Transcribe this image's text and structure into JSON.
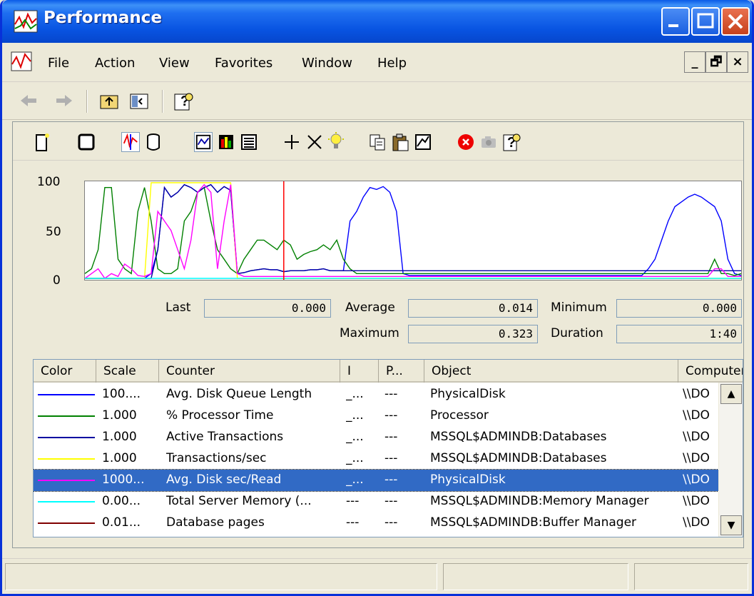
{
  "window": {
    "title": "Performance"
  },
  "menu": {
    "items": [
      {
        "label": "File",
        "mnemonic": "F"
      },
      {
        "label": "Action",
        "mnemonic": "A"
      },
      {
        "label": "View",
        "mnemonic": "V"
      },
      {
        "label": "Favorites",
        "mnemonic": "o"
      },
      {
        "label": "Window",
        "mnemonic": "W"
      },
      {
        "label": "Help",
        "mnemonic": "H"
      }
    ],
    "mdi": {
      "minimize": "_",
      "restore": "🗗",
      "close": "×"
    }
  },
  "stats": {
    "last_label": "Last",
    "last_value": "0.000",
    "average_label": "Average",
    "average_value": "0.014",
    "minimum_label": "Minimum",
    "minimum_value": "0.000",
    "maximum_label": "Maximum",
    "maximum_value": "0.323",
    "duration_label": "Duration",
    "duration_value": "1:40"
  },
  "list": {
    "columns": [
      "Color",
      "Scale",
      "Counter",
      "I",
      "P...",
      "Object",
      "Computer"
    ],
    "rows": [
      {
        "color": "#0000ff",
        "scale": "100....",
        "counter": "Avg. Disk Queue Length",
        "instance": "_...",
        "parent": "---",
        "object": "PhysicalDisk",
        "computer": "\\\\DO"
      },
      {
        "color": "#008000",
        "scale": "1.000",
        "counter": "% Processor Time",
        "instance": "_...",
        "parent": "---",
        "object": "Processor",
        "computer": "\\\\DO"
      },
      {
        "color": "#0000a0",
        "scale": "1.000",
        "counter": "Active Transactions",
        "instance": "_...",
        "parent": "---",
        "object": "MSSQL$ADMINDB:Databases",
        "computer": "\\\\DO"
      },
      {
        "color": "#ffff00",
        "scale": "1.000",
        "counter": "Transactions/sec",
        "instance": "_...",
        "parent": "---",
        "object": "MSSQL$ADMINDB:Databases",
        "computer": "\\\\DO"
      },
      {
        "color": "#ff00ff",
        "scale": "1000...",
        "counter": "Avg. Disk sec/Read",
        "instance": "_...",
        "parent": "---",
        "object": "PhysicalDisk",
        "computer": "\\\\DO",
        "selected": true
      },
      {
        "color": "#00ffff",
        "scale": "0.00...",
        "counter": "Total Server Memory (...",
        "instance": "---",
        "parent": "---",
        "object": "MSSQL$ADMINDB:Memory Manager",
        "computer": "\\\\DO"
      },
      {
        "color": "#800000",
        "scale": "0.01...",
        "counter": "Database pages",
        "instance": "---",
        "parent": "---",
        "object": "MSSQL$ADMINDB:Buffer Manager",
        "computer": "\\\\DO"
      }
    ]
  },
  "chart_data": {
    "type": "line",
    "ylim": [
      0,
      100
    ],
    "yticks": [
      "100",
      "50",
      "0"
    ],
    "x": [
      0,
      1,
      2,
      3,
      4,
      5,
      6,
      7,
      8,
      9,
      10,
      11,
      12,
      13,
      14,
      15,
      16,
      17,
      18,
      19,
      20,
      21,
      22,
      23,
      24,
      25,
      26,
      27,
      28,
      29,
      30,
      31,
      32,
      33,
      34,
      35,
      36,
      37,
      38,
      39,
      40,
      41,
      42,
      43,
      44,
      45,
      46,
      47,
      48,
      49,
      50,
      51,
      52,
      53,
      54,
      55,
      56,
      57,
      58,
      59,
      60,
      61,
      62,
      63,
      64,
      65,
      66,
      67,
      68,
      69,
      70,
      71,
      72,
      73,
      74,
      75,
      76,
      77,
      78,
      79,
      80,
      81,
      82,
      83,
      84,
      85,
      86,
      87,
      88,
      89,
      90,
      91,
      92,
      93,
      94,
      95,
      96,
      97,
      98,
      99
    ],
    "series": [
      {
        "color": "#0000ff",
        "values": [
          0,
          0,
          0,
          0,
          0,
          0,
          0,
          0,
          0,
          0,
          5,
          30,
          95,
          85,
          90,
          98,
          95,
          90,
          95,
          98,
          90,
          96,
          92,
          5,
          6,
          8,
          9,
          10,
          9,
          9,
          7,
          8,
          8,
          8,
          9,
          9,
          10,
          8,
          8,
          8,
          60,
          70,
          85,
          95,
          93,
          96,
          90,
          70,
          5,
          3,
          3,
          3,
          3,
          3,
          3,
          3,
          3,
          3,
          3,
          3,
          3,
          3,
          3,
          3,
          3,
          3,
          3,
          3,
          3,
          3,
          3,
          3,
          3,
          3,
          3,
          3,
          3,
          3,
          3,
          3,
          3,
          3,
          3,
          3,
          3,
          10,
          20,
          40,
          60,
          75,
          80,
          85,
          88,
          85,
          80,
          75,
          60,
          20,
          5,
          3
        ]
      },
      {
        "color": "#008000",
        "values": [
          5,
          10,
          30,
          95,
          95,
          20,
          10,
          5,
          70,
          95,
          60,
          10,
          5,
          5,
          10,
          60,
          70,
          90,
          95,
          60,
          30,
          20,
          10,
          5,
          20,
          30,
          40,
          40,
          35,
          30,
          40,
          35,
          20,
          25,
          28,
          30,
          35,
          30,
          40,
          20,
          10,
          5,
          5,
          5,
          5,
          5,
          5,
          5,
          5,
          5,
          5,
          5,
          5,
          5,
          5,
          5,
          5,
          5,
          5,
          5,
          5,
          5,
          5,
          5,
          5,
          5,
          5,
          5,
          5,
          5,
          5,
          5,
          5,
          5,
          5,
          5,
          5,
          5,
          5,
          5,
          5,
          5,
          5,
          5,
          5,
          5,
          5,
          5,
          5,
          5,
          5,
          5,
          5,
          5,
          5,
          20,
          5,
          5,
          3,
          5
        ]
      },
      {
        "color": "#0000a0",
        "values": [
          0,
          0,
          0,
          0,
          0,
          0,
          0,
          0,
          0,
          0,
          0,
          30,
          95,
          85,
          90,
          98,
          95,
          90,
          95,
          98,
          90,
          96,
          92,
          5,
          6,
          8,
          9,
          10,
          9,
          9,
          7,
          8,
          8,
          8,
          9,
          9,
          10,
          8,
          8,
          8,
          8,
          8,
          8,
          8,
          8,
          8,
          8,
          8,
          8,
          8,
          8,
          8,
          8,
          8,
          8,
          8,
          8,
          8,
          8,
          8,
          8,
          8,
          8,
          8,
          8,
          8,
          8,
          8,
          8,
          8,
          8,
          8,
          8,
          8,
          8,
          8,
          8,
          8,
          8,
          8,
          8,
          8,
          8,
          8,
          8,
          8,
          8,
          8,
          8,
          8,
          8,
          8,
          8,
          8,
          8,
          8,
          8,
          8,
          8,
          8
        ]
      },
      {
        "color": "#ffff00",
        "values": [
          0,
          0,
          0,
          0,
          0,
          0,
          0,
          0,
          0,
          0,
          100,
          100,
          100,
          100,
          100,
          100,
          100,
          100,
          100,
          100,
          100,
          100,
          100,
          0,
          0,
          0,
          0,
          0,
          0,
          0,
          0,
          0,
          0,
          0,
          0,
          0,
          0,
          0,
          0,
          0,
          0,
          0,
          0,
          0,
          0,
          0,
          0,
          0,
          0,
          0,
          0,
          0,
          0,
          0,
          0,
          0,
          0,
          0,
          0,
          0,
          0,
          0,
          0,
          0,
          0,
          0,
          0,
          0,
          0,
          0,
          0,
          0,
          0,
          0,
          0,
          0,
          0,
          0,
          0,
          0,
          0,
          0,
          0,
          0,
          0,
          0,
          0,
          0,
          0,
          0,
          0,
          0,
          0,
          0,
          0,
          0,
          0,
          0,
          0,
          0
        ]
      },
      {
        "color": "#ff00ff",
        "values": [
          0,
          5,
          10,
          0,
          5,
          2,
          15,
          10,
          3,
          2,
          5,
          70,
          60,
          50,
          30,
          10,
          40,
          90,
          98,
          90,
          10,
          60,
          98,
          5,
          2,
          2,
          2,
          2,
          2,
          2,
          2,
          2,
          2,
          2,
          2,
          2,
          2,
          2,
          2,
          2,
          2,
          2,
          2,
          2,
          2,
          2,
          2,
          2,
          2,
          2,
          2,
          2,
          2,
          2,
          2,
          2,
          2,
          2,
          2,
          2,
          2,
          2,
          2,
          2,
          2,
          2,
          2,
          2,
          2,
          2,
          2,
          2,
          2,
          2,
          2,
          2,
          2,
          2,
          2,
          2,
          2,
          2,
          2,
          2,
          2,
          2,
          2,
          2,
          2,
          2,
          2,
          2,
          2,
          2,
          2,
          10,
          10,
          2,
          2,
          2
        ]
      },
      {
        "color": "#00ffff",
        "values": [
          0,
          0,
          0,
          0,
          0,
          0,
          0,
          0,
          0,
          0,
          0,
          0,
          0,
          0,
          0,
          0,
          0,
          0,
          0,
          0,
          0,
          0,
          0,
          0,
          0,
          0,
          0,
          0,
          0,
          0,
          0,
          0,
          0,
          0,
          0,
          0,
          0,
          0,
          0,
          0,
          0,
          0,
          0,
          0,
          0,
          0,
          0,
          0,
          0,
          0,
          0,
          0,
          0,
          0,
          0,
          0,
          0,
          0,
          0,
          0,
          0,
          0,
          0,
          0,
          0,
          0,
          0,
          0,
          0,
          0,
          0,
          0,
          0,
          0,
          0,
          0,
          0,
          0,
          0,
          0,
          0,
          0,
          0,
          0,
          0,
          0,
          0,
          0,
          0,
          0,
          0,
          0,
          0,
          0,
          0,
          0,
          0,
          0,
          0,
          0
        ]
      },
      {
        "color": "#ff0000",
        "values": [
          0,
          0,
          0,
          0,
          0,
          0,
          0,
          0,
          0,
          0,
          0,
          0,
          0,
          0,
          0,
          0,
          0,
          0,
          0,
          0,
          0,
          0,
          0,
          0,
          0,
          0,
          0,
          0,
          0,
          0,
          0,
          0,
          0,
          0,
          0,
          0,
          0,
          0,
          0,
          0,
          0,
          0,
          0,
          0,
          0,
          0,
          0,
          0,
          0,
          0,
          0,
          0,
          0,
          0,
          0,
          0,
          0,
          0,
          0,
          0,
          0,
          0,
          0,
          0,
          0,
          0,
          0,
          0,
          0,
          0,
          0,
          0,
          0,
          0,
          0,
          0,
          0,
          0,
          0,
          0,
          0,
          0,
          0,
          0,
          0,
          0,
          0,
          0,
          0,
          0,
          0,
          0,
          0,
          0,
          0,
          0,
          0,
          0,
          0,
          0
        ]
      }
    ],
    "timebar_index": 30
  }
}
